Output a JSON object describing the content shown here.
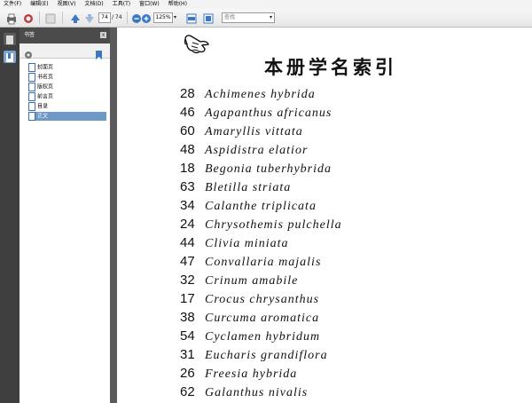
{
  "menu": [
    "文件(F)",
    "编辑(E)",
    "视图(V)",
    "文档(D)",
    "工具(T)",
    "窗口(W)",
    "帮助(H)"
  ],
  "toolbar": {
    "page_current": "74",
    "page_total": "/ 74",
    "zoom": "125%",
    "search_placeholder": "查找"
  },
  "bookmarks": {
    "title": "书签",
    "close": "x",
    "items": [
      "封面页",
      "书名页",
      "版权页",
      "前言页",
      "目录",
      "正文"
    ],
    "selected_index": 5
  },
  "document": {
    "title": "本册学名索引",
    "entries": [
      {
        "page": "28",
        "name": "Achimenes hybrida"
      },
      {
        "page": "46",
        "name": "Agapanthus africanus"
      },
      {
        "page": "60",
        "name": "Amaryllis vittata"
      },
      {
        "page": "48",
        "name": "Aspidistra elatior"
      },
      {
        "page": "18",
        "name": "Begonia tuberhybrida"
      },
      {
        "page": "63",
        "name": "Bletilla striata"
      },
      {
        "page": "34",
        "name": "Calanthe triplicata"
      },
      {
        "page": "24",
        "name": "Chrysothemis pulchella"
      },
      {
        "page": "44",
        "name": "Clivia miniata"
      },
      {
        "page": "47",
        "name": "Convallaria majalis"
      },
      {
        "page": "32",
        "name": "Crinum amabile"
      },
      {
        "page": "17",
        "name": "Crocus chrysanthus"
      },
      {
        "page": "38",
        "name": "Curcuma aromatica"
      },
      {
        "page": "54",
        "name": "Cyclamen hybridum"
      },
      {
        "page": "31",
        "name": "Eucharis grandiflora"
      },
      {
        "page": "26",
        "name": "Freesia hybrida"
      },
      {
        "page": "62",
        "name": "Galanthus nivalis"
      }
    ]
  }
}
